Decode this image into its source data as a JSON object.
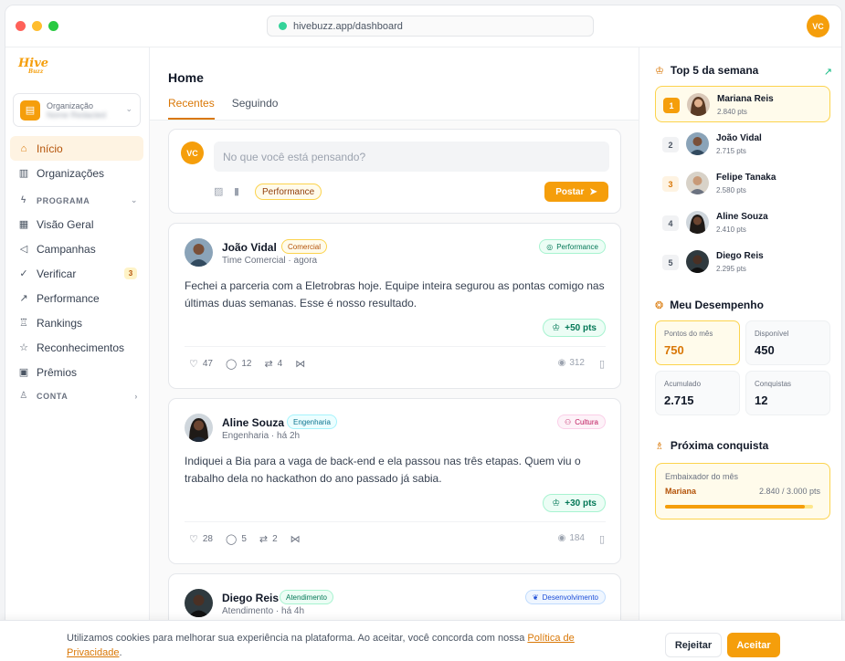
{
  "browser": {
    "url": "hivebuzz.app/dashboard",
    "user_initials": "VC"
  },
  "sidebar": {
    "logo_main": "Hive",
    "logo_sub": "Buzz",
    "org_caption": "Organização",
    "org_name": "Nome Redacted",
    "items": [
      {
        "label": "Início",
        "icon": "home-icon"
      },
      {
        "label": "Organizações",
        "icon": "building-icon"
      }
    ],
    "program_section": "PROGRAMA",
    "program_items": [
      {
        "label": "Visão Geral",
        "icon": "grid-icon"
      },
      {
        "label": "Campanhas",
        "icon": "megaphone-icon"
      },
      {
        "label": "Verificar",
        "icon": "check-circle-icon",
        "badge": "3"
      },
      {
        "label": "Performance",
        "icon": "trend-icon"
      },
      {
        "label": "Rankings",
        "icon": "trophy-icon"
      },
      {
        "label": "Reconhecimentos",
        "icon": "star-icon"
      },
      {
        "label": "Prêmios",
        "icon": "gift-icon"
      }
    ],
    "account_section": "CONTA"
  },
  "main": {
    "title": "Home",
    "tabs": [
      "Recentes",
      "Seguindo"
    ],
    "composer": {
      "initials": "VC",
      "placeholder": "No que você está pensando?",
      "tag": "Performance",
      "post_label": "Postar"
    },
    "posts": [
      {
        "author": "João Vidal",
        "team": "Comercial",
        "meta": "Time Comercial · agora",
        "category": "Performance",
        "text": "Fechei a parceria com a Eletrobras hoje. Equipe inteira segurou as pontas comigo nas últimas duas semanas. Esse é nosso resultado.",
        "points": "+50 pts",
        "likes": "47",
        "comments": "12",
        "reposts": "4",
        "views": "312"
      },
      {
        "author": "Aline Souza",
        "team": "Engenharia",
        "meta": "Engenharia · há 2h",
        "category": "Cultura",
        "text": "Indiquei a Bia para a vaga de back-end e ela passou nas três etapas. Quem viu o trabalho dela no hackathon do ano passado já sabia.",
        "points": "+30 pts",
        "likes": "28",
        "comments": "5",
        "reposts": "2",
        "views": "184"
      },
      {
        "author": "Diego Reis",
        "team": "Atendimento",
        "meta": "Atendimento · há 4h",
        "category": "Desenvolvimento"
      }
    ]
  },
  "right": {
    "top5_title": "Top 5 da semana",
    "ranking": [
      {
        "pos": "1",
        "name": "Mariana Reis",
        "pts": "2.840 pts"
      },
      {
        "pos": "2",
        "name": "João Vidal",
        "pts": "2.715 pts"
      },
      {
        "pos": "3",
        "name": "Felipe Tanaka",
        "pts": "2.580 pts"
      },
      {
        "pos": "4",
        "name": "Aline Souza",
        "pts": "2.410 pts"
      },
      {
        "pos": "5",
        "name": "Diego Reis",
        "pts": "2.295 pts"
      }
    ],
    "perf_title": "Meu Desempenho",
    "stats": [
      {
        "label": "Pontos do mês",
        "value": "750"
      },
      {
        "label": "Disponível",
        "value": "450"
      },
      {
        "label": "Acumulado",
        "value": "2.715"
      },
      {
        "label": "Conquistas",
        "value": "12"
      }
    ],
    "next_title": "Próxima conquista",
    "next_goal": {
      "name": "Embaixador do mês",
      "leader": "Mariana",
      "progress_text": "2.840 / 3.000 pts",
      "progress_fraction": 0.947
    }
  },
  "cookie": {
    "text": "Utilizamos cookies para melhorar sua experiência na plataforma. Ao aceitar, você concorda com nossa ",
    "link": "Política de Privacidade",
    "reject": "Rejeitar",
    "accept": "Aceitar"
  },
  "colors": {
    "accent": "#f59e0b",
    "accent_dark": "#d97706"
  }
}
